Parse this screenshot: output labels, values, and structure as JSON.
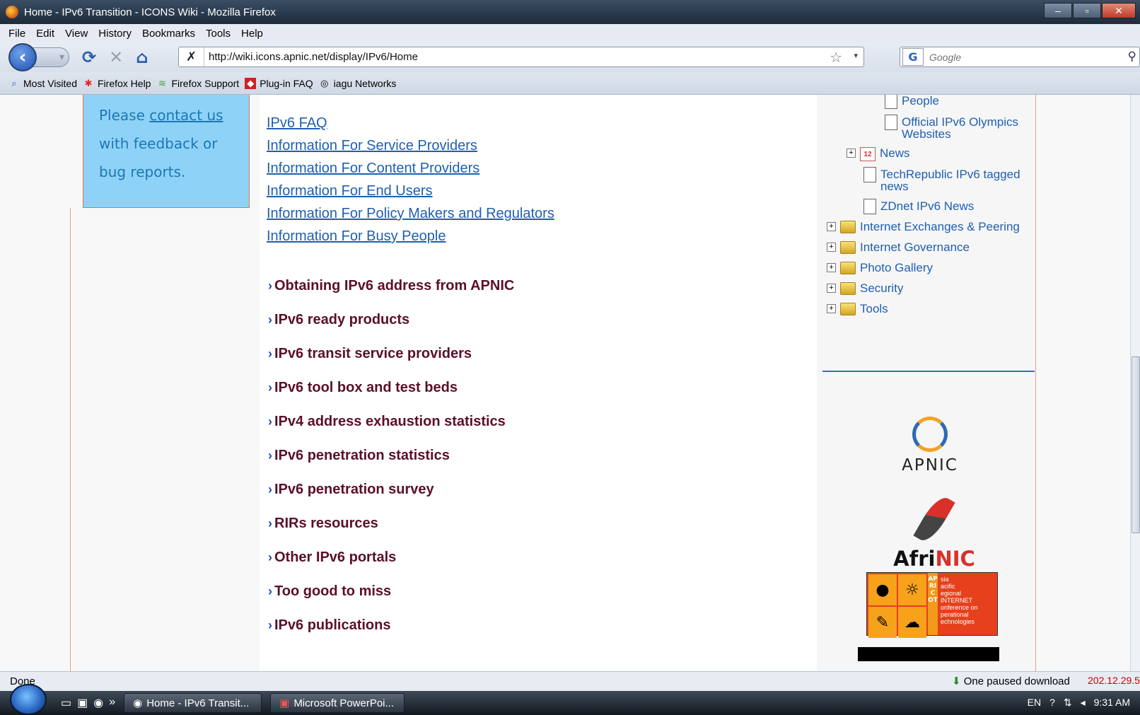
{
  "window": {
    "title": "Home - IPv6 Transition - ICONS Wiki - Mozilla Firefox",
    "minimize": "–",
    "maximize": "▫",
    "close": "✕"
  },
  "menu": [
    "File",
    "Edit",
    "View",
    "History",
    "Bookmarks",
    "Tools",
    "Help"
  ],
  "nav": {
    "url": "http://wiki.icons.apnic.net/display/IPv6/Home",
    "search_placeholder": "Google"
  },
  "bookmarks": [
    "Most Visited",
    "Firefox Help",
    "Firefox Support",
    "Plug-in FAQ",
    "iagu Networks"
  ],
  "left_panel": {
    "line1": "Please",
    "link": "contact us",
    "line2": "with feedback or",
    "line3": "bug reports."
  },
  "quick_links": [
    "IPv6 FAQ",
    "Information For Service Providers",
    "Information For Content Providers",
    "Information For End Users",
    "Information For Policy Makers and Regulators",
    "Information For Busy People"
  ],
  "sections": [
    "Obtaining IPv6 address from APNIC",
    "IPv6 ready products",
    "IPv6 transit service providers",
    "IPv6 tool box and test beds",
    "IPv4 address exhaustion statistics",
    "IPv6 penetration statistics",
    "IPv6 penetration survey",
    "RIRs resources",
    "Other IPv6 portals",
    "Too good to miss",
    "IPv6 publications"
  ],
  "tree": {
    "people": "People",
    "olympics_line1": "Official IPv6 Olympics",
    "olympics_line2": "Websites",
    "news": "News",
    "calendar_day": "12",
    "techrepublic_line1": "TechRepublic IPv6 tagged",
    "techrepublic_line2": "news",
    "zdnet": "ZDnet IPv6 News",
    "folders": [
      "Internet Exchanges & Peering",
      "Internet Governance",
      "Photo Gallery",
      "Security",
      "Tools"
    ]
  },
  "logos": {
    "apnic": "APNIC",
    "afrinic_a": "Afri",
    "afrinic_b": "NIC",
    "apricot_letters": "APRICOT",
    "apricot_text": [
      "sia",
      "acific",
      "egional",
      "INTERNET",
      "onference on",
      "perational",
      "echnologies"
    ]
  },
  "status": {
    "text": "Done",
    "download": "One paused download",
    "ip": "202.12.29.5"
  },
  "taskbar": {
    "tasks": [
      "Home - IPv6 Transit...",
      "Microsoft PowerPoi..."
    ],
    "lang": "EN",
    "time": "9:31 AM"
  }
}
